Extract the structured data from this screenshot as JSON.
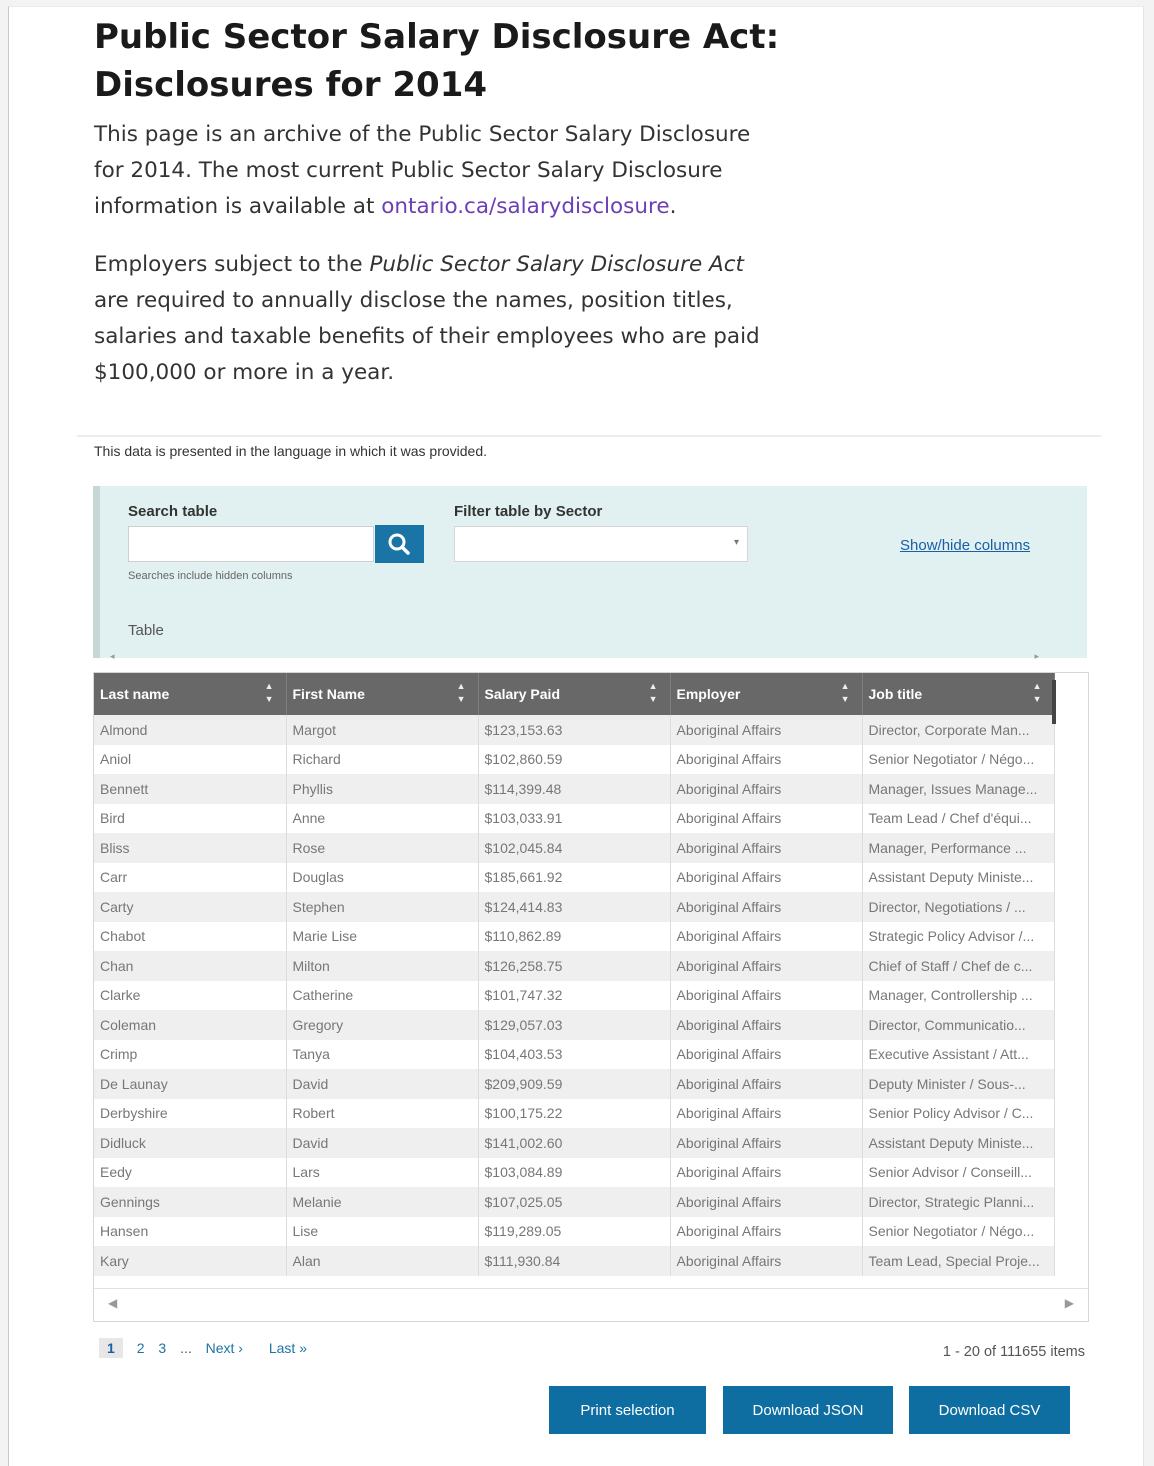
{
  "header": {
    "title": "Public Sector Salary Disclosure Act: Disclosures for 2014"
  },
  "intro": {
    "p1_before_link": "This page is an archive of the Public Sector Salary Disclosure for 2014. The most current Public Sector Salary Disclosure information is available at ",
    "p1_link": "ontario.ca/salarydisclosure",
    "p1_after_link": ".",
    "p2_before_em": "Employers subject to the ",
    "p2_em": "Public Sector Salary Disclosure Act",
    "p2_after_em": " are required to annually disclose the names, position titles, salaries and taxable benefits of their employees who are paid $100,000 or more in a year."
  },
  "lang_note": "This data is presented in the language in which it was provided.",
  "controls": {
    "search_label": "Search table",
    "search_value": "",
    "search_hint": "Searches include hidden columns",
    "filter_label": "Filter table by Sector",
    "filter_value": "",
    "show_hide": "Show/hide columns",
    "table_caption": "Table"
  },
  "table": {
    "columns": [
      "Last name",
      "First Name",
      "Salary Paid",
      "Employer",
      "Job title"
    ],
    "rows": [
      [
        "Almond",
        "Margot",
        "$123,153.63",
        "Aboriginal Affairs",
        "Director, Corporate Man..."
      ],
      [
        "Aniol",
        "Richard",
        "$102,860.59",
        "Aboriginal Affairs",
        "Senior Negotiator / Négo..."
      ],
      [
        "Bennett",
        "Phyllis",
        "$114,399.48",
        "Aboriginal Affairs",
        "Manager, Issues Manage..."
      ],
      [
        "Bird",
        "Anne",
        "$103,033.91",
        "Aboriginal Affairs",
        "Team Lead / Chef d'équi..."
      ],
      [
        "Bliss",
        "Rose",
        "$102,045.84",
        "Aboriginal Affairs",
        "Manager, Performance ..."
      ],
      [
        "Carr",
        "Douglas",
        "$185,661.92",
        "Aboriginal Affairs",
        "Assistant Deputy Ministe..."
      ],
      [
        "Carty",
        "Stephen",
        "$124,414.83",
        "Aboriginal Affairs",
        "Director, Negotiations / ..."
      ],
      [
        "Chabot",
        "Marie Lise",
        "$110,862.89",
        "Aboriginal Affairs",
        "Strategic Policy Advisor /..."
      ],
      [
        "Chan",
        "Milton",
        "$126,258.75",
        "Aboriginal Affairs",
        "Chief of Staff / Chef de c..."
      ],
      [
        "Clarke",
        "Catherine",
        "$101,747.32",
        "Aboriginal Affairs",
        "Manager, Controllership ..."
      ],
      [
        "Coleman",
        "Gregory",
        "$129,057.03",
        "Aboriginal Affairs",
        "Director, Communicatio..."
      ],
      [
        "Crimp",
        "Tanya",
        "$104,403.53",
        "Aboriginal Affairs",
        "Executive Assistant / Att..."
      ],
      [
        "De Launay",
        "David",
        "$209,909.59",
        "Aboriginal Affairs",
        "Deputy Minister / Sous-..."
      ],
      [
        "Derbyshire",
        "Robert",
        "$100,175.22",
        "Aboriginal Affairs",
        "Senior Policy Advisor / C..."
      ],
      [
        "Didluck",
        "David",
        "$141,002.60",
        "Aboriginal Affairs",
        "Assistant Deputy Ministe..."
      ],
      [
        "Eedy",
        "Lars",
        "$103,084.89",
        "Aboriginal Affairs",
        "Senior Advisor / Conseill..."
      ],
      [
        "Gennings",
        "Melanie",
        "$107,025.05",
        "Aboriginal Affairs",
        "Director, Strategic Planni..."
      ],
      [
        "Hansen",
        "Lise",
        "$119,289.05",
        "Aboriginal Affairs",
        "Senior Negotiator / Négo..."
      ],
      [
        "Kary",
        "Alan",
        "$111,930.84",
        "Aboriginal Affairs",
        "Team Lead, Special Proje..."
      ]
    ]
  },
  "pagination": {
    "pages": [
      "1",
      "2",
      "3"
    ],
    "ellipsis": "...",
    "next": "Next ›",
    "last": "Last »",
    "items_text": "1 - 20 of 111655 items"
  },
  "buttons": {
    "print": "Print selection",
    "json": "Download JSON",
    "csv": "Download CSV"
  },
  "colors": {
    "accent": "#0f6ea1",
    "link": "#6c3fb5",
    "filter_panel": "#e1f1f1",
    "header_row": "#686868"
  }
}
